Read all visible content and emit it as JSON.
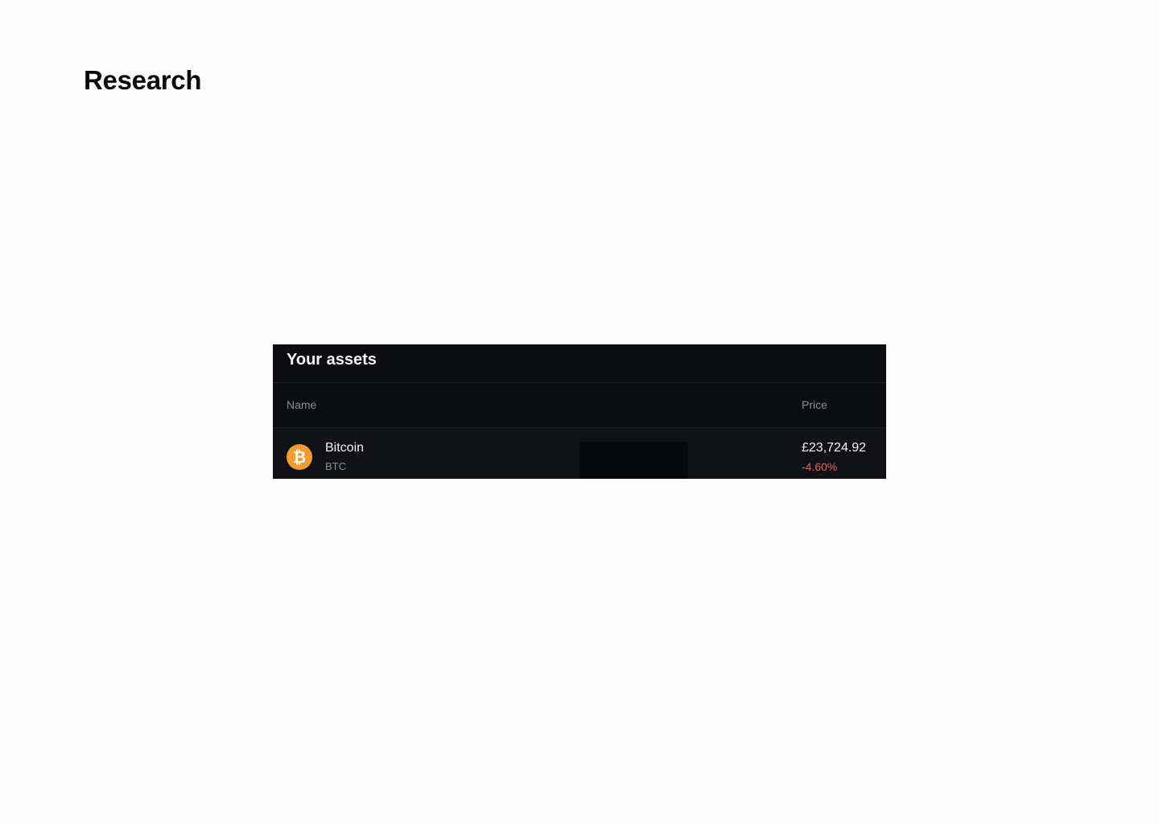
{
  "page": {
    "title": "Research"
  },
  "assets_panel": {
    "title": "Your assets",
    "columns": {
      "name": "Name",
      "price": "Price"
    },
    "rows": [
      {
        "name": "Bitcoin",
        "symbol": "BTC",
        "icon": "bitcoin-icon",
        "icon_glyph": "₿",
        "icon_color": "#f39a2f",
        "price": "£23,724.92",
        "change": "-4.60%",
        "change_color": "#e0605d"
      }
    ]
  }
}
